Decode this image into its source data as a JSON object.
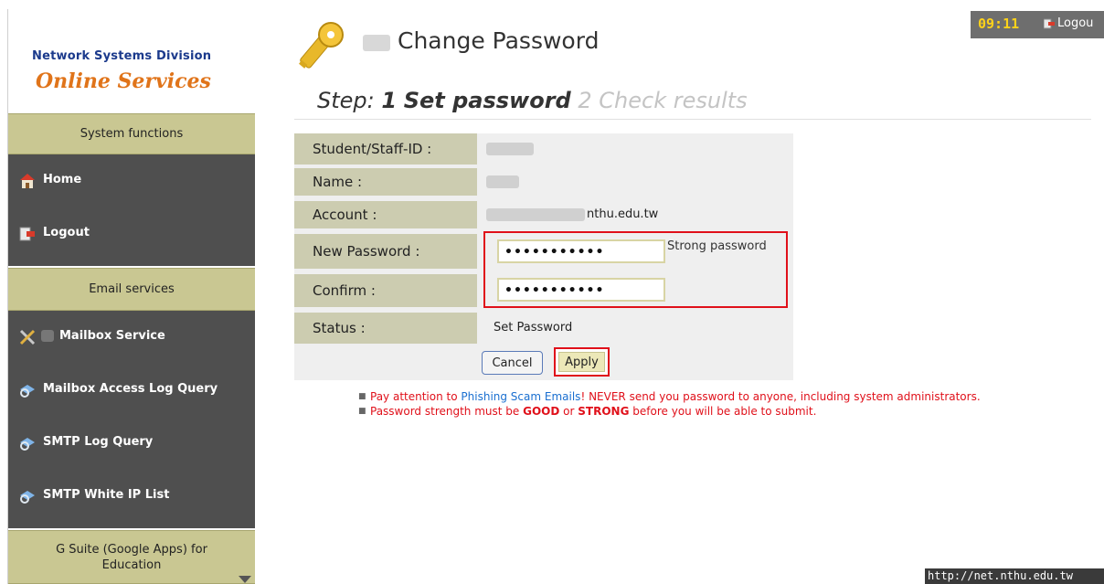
{
  "sidebar": {
    "org_name": "Network Systems Division",
    "service_title": "Online Services",
    "sections": [
      {
        "title": "System functions",
        "items": [
          {
            "label": "Home",
            "icon": "home-icon"
          },
          {
            "label": "Logout",
            "icon": "logout-icon"
          }
        ]
      },
      {
        "title": "Email services",
        "items": [
          {
            "label": "Mailbox Service",
            "icon": "tools-icon"
          },
          {
            "label": "Mailbox Access Log Query",
            "icon": "search-icon"
          },
          {
            "label": "SMTP Log Query",
            "icon": "search-icon"
          },
          {
            "label": "SMTP White IP List",
            "icon": "search-icon"
          }
        ]
      },
      {
        "title": "G Suite (Google Apps) for Education",
        "items": []
      }
    ]
  },
  "header": {
    "title": "Change Password",
    "steps": {
      "prefix": "Step:",
      "step1_num": "1",
      "step1_label": "Set password",
      "step2": "2 Check results"
    }
  },
  "form": {
    "rows": [
      {
        "label": "Student/Staff-ID :",
        "value": ""
      },
      {
        "label": "Name :",
        "value": ""
      },
      {
        "label": "Account :",
        "value": "nthu.edu.tw"
      },
      {
        "label": "New Password :",
        "value": "•••••••••••"
      },
      {
        "label": "Confirm :",
        "value": "•••••••••••"
      },
      {
        "label": "Status :",
        "value": "Set Password"
      }
    ],
    "strength": "Strong password",
    "cancel_label": "Cancel",
    "apply_label": "Apply"
  },
  "notes": {
    "n1_a": "Pay attention to",
    "n1_link": "Phishing Scam Emails",
    "n1_b": "! NEVER send you password to anyone, including system administrators.",
    "n2_a": "Password strength must be",
    "n2_good": "GOOD",
    "n2_or": "or",
    "n2_strong": "STRONG",
    "n2_b": "before you will be able to submit."
  },
  "topbar": {
    "clock": "09:11",
    "logout": "Logou"
  },
  "statusbar": {
    "url": "http://net.nthu.edu.tw"
  },
  "colors": {
    "sidebar_bg": "#4f4f4f",
    "section_head": "#c9c792",
    "brand_blue": "#1b3a8c",
    "brand_orange": "#e0741a",
    "highlight_red": "#e0101a",
    "clock_yellow": "#ffd21a"
  }
}
